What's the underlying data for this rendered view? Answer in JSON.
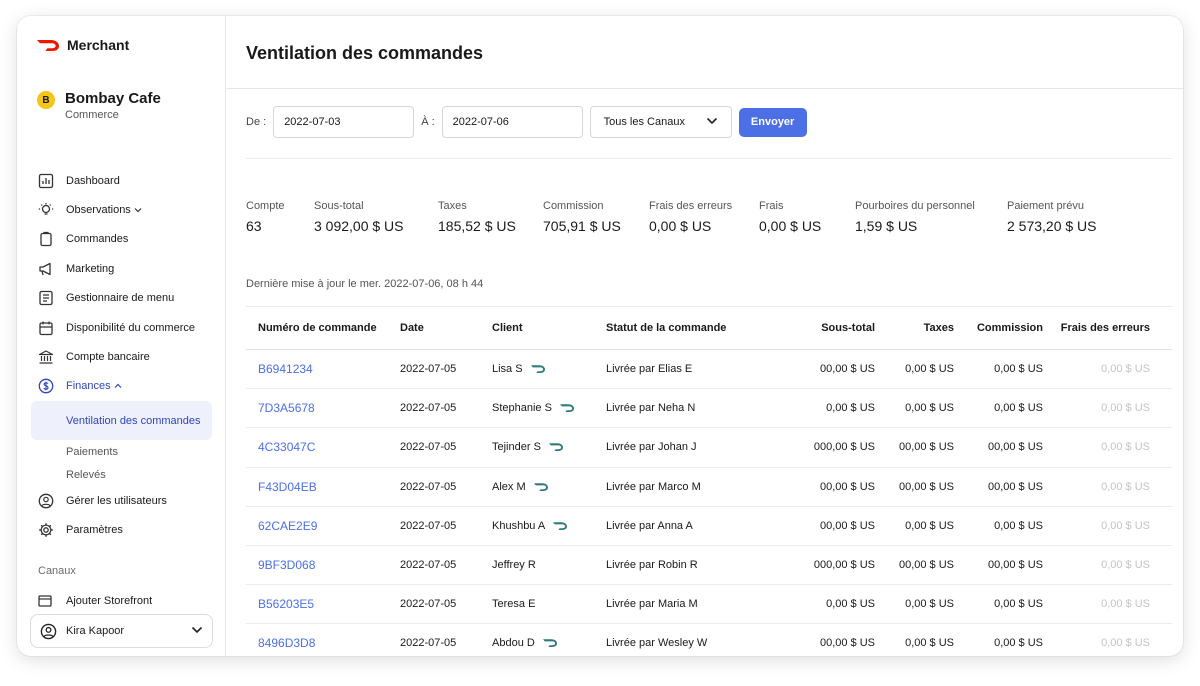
{
  "brand": {
    "name": "Merchant",
    "logo_color": "#eb1700"
  },
  "store": {
    "badge": "B",
    "name": "Bombay Cafe",
    "type": "Commerce"
  },
  "nav": {
    "dashboard": "Dashboard",
    "observations": "Observations",
    "orders": "Commandes",
    "marketing": "Marketing",
    "menu_manager": "Gestionnaire de menu",
    "availability": "Disponibilité du commerce",
    "bank_account": "Compte bancaire",
    "finances": "Finances",
    "finances_sub": [
      "Ventilation des commandes",
      "Paiements",
      "Relevés"
    ],
    "users": "Gérer les utilisateurs",
    "settings": "Paramètres",
    "channels_label": "Canaux",
    "add_storefront": "Ajouter Storefront"
  },
  "user": {
    "name": "Kira Kapoor"
  },
  "page": {
    "title": "Ventilation des commandes"
  },
  "filters": {
    "from_label": "De :",
    "from_value": "2022-07-03",
    "to_label": "À :",
    "to_value": "2022-07-06",
    "channel_value": "Tous les Canaux",
    "submit_label": "Envoyer"
  },
  "stats": [
    {
      "label": "Compte",
      "value": "63"
    },
    {
      "label": "Sous-total",
      "value": "3 092,00 $ US"
    },
    {
      "label": "Taxes",
      "value": "185,52 $ US"
    },
    {
      "label": "Commission",
      "value": "705,91 $ US"
    },
    {
      "label": "Frais des erreurs",
      "value": "0,00 $ US"
    },
    {
      "label": "Frais",
      "value": "0,00 $ US"
    },
    {
      "label": "Pourboires du personnel",
      "value": "1,59 $ US"
    },
    {
      "label": "Paiement prévu",
      "value": "2 573,20 $ US"
    }
  ],
  "last_updated": "Dernière mise à jour le mer. 2022-07-06, 08 h 44",
  "table": {
    "headers": [
      "Numéro de commande",
      "Date",
      "Client",
      "Statut de la commande",
      "Sous-total",
      "Taxes",
      "Commission",
      "Frais des erreurs"
    ],
    "rows": [
      {
        "number": "B6941234",
        "date": "2022-07-05",
        "client": "Lisa S",
        "dasher": true,
        "status": "Livrée par Elias E",
        "subtotal": "00,00 $ US",
        "taxes": "0,00 $ US",
        "commission": "0,00 $ US",
        "errors": "0,00 $ US"
      },
      {
        "number": "7D3A5678",
        "date": "2022-07-05",
        "client": "Stephanie S",
        "dasher": true,
        "status": "Livrée par Neha N",
        "subtotal": "0,00 $ US",
        "taxes": "0,00 $ US",
        "commission": "0,00 $ US",
        "errors": "0,00 $ US"
      },
      {
        "number": "4C33047C",
        "date": "2022-07-05",
        "client": "Tejinder S",
        "dasher": true,
        "status": "Livrée par Johan J",
        "subtotal": "000,00 $ US",
        "taxes": "00,00 $ US",
        "commission": "00,00 $ US",
        "errors": "0,00 $ US"
      },
      {
        "number": "F43D04EB",
        "date": "2022-07-05",
        "client": "Alex M",
        "dasher": true,
        "status": "Livrée par Marco M",
        "subtotal": "00,00 $ US",
        "taxes": "00,00 $ US",
        "commission": "00,00 $ US",
        "errors": "0,00 $ US"
      },
      {
        "number": "62CAE2E9",
        "date": "2022-07-05",
        "client": "Khushbu A",
        "dasher": true,
        "status": "Livrée par Anna A",
        "subtotal": "00,00 $ US",
        "taxes": "0,00 $ US",
        "commission": "0,00 $ US",
        "errors": "0,00 $ US"
      },
      {
        "number": "9BF3D068",
        "date": "2022-07-05",
        "client": "Jeffrey R",
        "dasher": false,
        "status": "Livrée par Robin R",
        "subtotal": "000,00 $ US",
        "taxes": "00,00 $ US",
        "commission": "00,00 $ US",
        "errors": "0,00 $ US"
      },
      {
        "number": "B56203E5",
        "date": "2022-07-05",
        "client": "Teresa E",
        "dasher": false,
        "status": "Livrée par Maria M",
        "subtotal": "0,00 $ US",
        "taxes": "0,00 $ US",
        "commission": "0,00 $ US",
        "errors": "0,00 $ US"
      },
      {
        "number": "8496D3D8",
        "date": "2022-07-05",
        "client": "Abdou D",
        "dasher": true,
        "status": "Livrée par Wesley W",
        "subtotal": "00,00 $ US",
        "taxes": "0,00 $ US",
        "commission": "0,00 $ US",
        "errors": "0,00 $ US"
      }
    ]
  },
  "colors": {
    "accent": "#4c6fe6",
    "active_nav": "#2e46b9",
    "dasher_icon": "#2f7a7a"
  }
}
